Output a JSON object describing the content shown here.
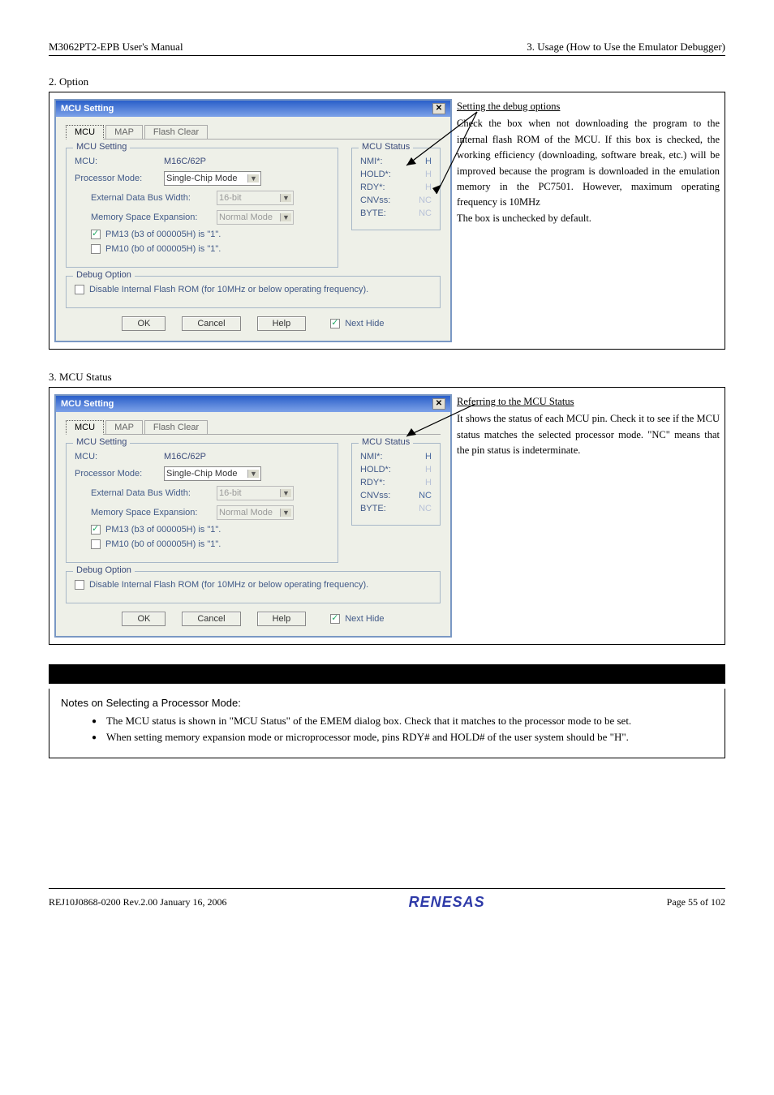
{
  "header": {
    "left": "M3062PT2-EPB User's Manual",
    "right": "3. Usage (How to Use the Emulator Debugger)"
  },
  "section2": {
    "num": "2. Option",
    "dialog_title": "MCU Setting",
    "tabs": [
      "MCU",
      "MAP",
      "Flash Clear"
    ],
    "fs1_legend": "MCU Setting",
    "mcu_label": "MCU:",
    "mcu_value": "M16C/62P",
    "pm_label": "Processor Mode:",
    "pm_value": "Single-Chip Mode",
    "edbw_label": "External Data Bus Width:",
    "edbw_value": "16-bit",
    "mse_label": "Memory Space Expansion:",
    "mse_value": "Normal Mode",
    "chk1": "PM13 (b3 of 000005H) is \"1\".",
    "chk2": "PM10 (b0 of 000005H) is \"1\".",
    "fs2_legend": "MCU Status",
    "status": {
      "NMI*": "H",
      "HOLD*": "H",
      "RDY*": "H",
      "CNVss": "NC",
      "BYTE": "NC"
    },
    "fs3_legend": "Debug Option",
    "debug_chk": "Disable Internal Flash ROM (for 10MHz or below operating frequency).",
    "btn_ok": "OK",
    "btn_cancel": "Cancel",
    "btn_help": "Help",
    "chk_nexthide": "Next Hide",
    "info_title": "Setting the debug options",
    "info_body": "Check the box when not downloading the program to the internal flash ROM of the MCU. If this box is checked, the working efficiency (downloading, software break, etc.) will be improved because the program is downloaded in the emulation memory in the PC7501. However, maximum operating frequency is 10MHz",
    "info_body2": "The box is unchecked by default."
  },
  "section3": {
    "num": "3. MCU Status",
    "status": {
      "NMI*": "H",
      "HOLD*": "H",
      "RDY*": "H",
      "CNVss": "NC",
      "BYTE": "NC"
    },
    "info_title": "Referring to the MCU Status",
    "info_body": "It shows the status of each MCU pin. Check it to see if the MCU status matches the selected processor mode. \"NC\" means that the pin status is indeterminate."
  },
  "notes": {
    "title": "Notes on Selecting a Processor Mode:",
    "b1": "The MCU status is shown in \"MCU Status\" of the EMEM dialog box. Check that it matches to the processor mode to be set.",
    "b2": "When setting memory expansion mode or microprocessor mode, pins RDY# and HOLD# of the user system should be \"H\"."
  },
  "footer": {
    "left": "REJ10J0868-0200   Rev.2.00   January 16, 2006",
    "logo": "RENESAS",
    "right": "Page 55 of 102"
  }
}
